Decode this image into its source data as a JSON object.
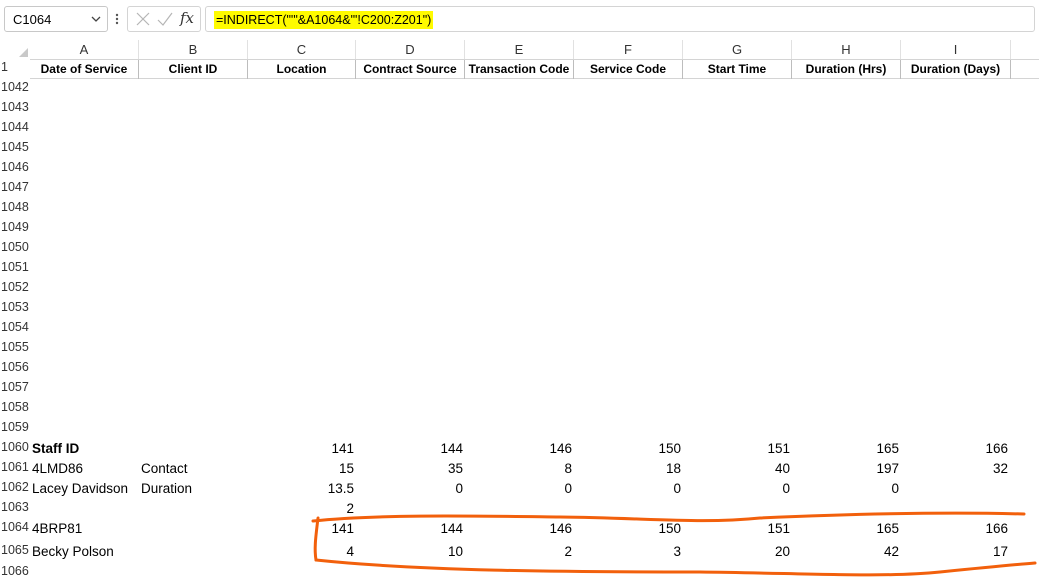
{
  "formula_bar": {
    "name_box": "C1064",
    "formula": "=INDIRECT(\"'\"&A1064&\"'!C200:Z201\")"
  },
  "columns": [
    "A",
    "B",
    "C",
    "D",
    "E",
    "F",
    "G",
    "H",
    "I"
  ],
  "header_row_number": "1",
  "headers": [
    "Date of Service",
    "Client ID",
    "Location",
    "Contract Source",
    "Transaction Code",
    "Service Code",
    "Start Time",
    "Duration (Hrs)",
    "Duration (Days)"
  ],
  "row_numbers": [
    "1042",
    "1043",
    "1044",
    "1045",
    "1046",
    "1047",
    "1048",
    "1049",
    "1050",
    "1051",
    "1052",
    "1053",
    "1054",
    "1055",
    "1056",
    "1057",
    "1058",
    "1059",
    "1060",
    "1061",
    "1062",
    "1063",
    "1064",
    "1065",
    "1066"
  ],
  "rows": {
    "r1060": {
      "a": "Staff ID",
      "c": "141",
      "d": "144",
      "e": "146",
      "f": "150",
      "g": "151",
      "h": "165",
      "i": "166"
    },
    "r1061": {
      "a": "4LMD86",
      "b": "Contact",
      "c": "15",
      "d": "35",
      "e": "8",
      "f": "18",
      "g": "40",
      "h": "197",
      "i": "32"
    },
    "r1062": {
      "a": "Lacey Davidson",
      "b": "Duration",
      "c": "13.5",
      "d": "0",
      "e": "0",
      "f": "0",
      "g": "0",
      "h": "0"
    },
    "r1063": {
      "c": "2"
    },
    "r1064": {
      "a": "4BRP81",
      "c": "141",
      "d": "144",
      "e": "146",
      "f": "150",
      "g": "151",
      "h": "165",
      "i": "166"
    },
    "r1065": {
      "a": "Becky Polson",
      "c": "4",
      "d": "10",
      "e": "2",
      "f": "3",
      "g": "20",
      "h": "42",
      "i": "17"
    }
  },
  "annotation_color": "#f2600c",
  "icons": {
    "cancel": "x-icon",
    "enter": "check-icon",
    "function": "fx-icon",
    "more": "more-vertical-icon",
    "dropdown": "chevron-down-icon"
  }
}
